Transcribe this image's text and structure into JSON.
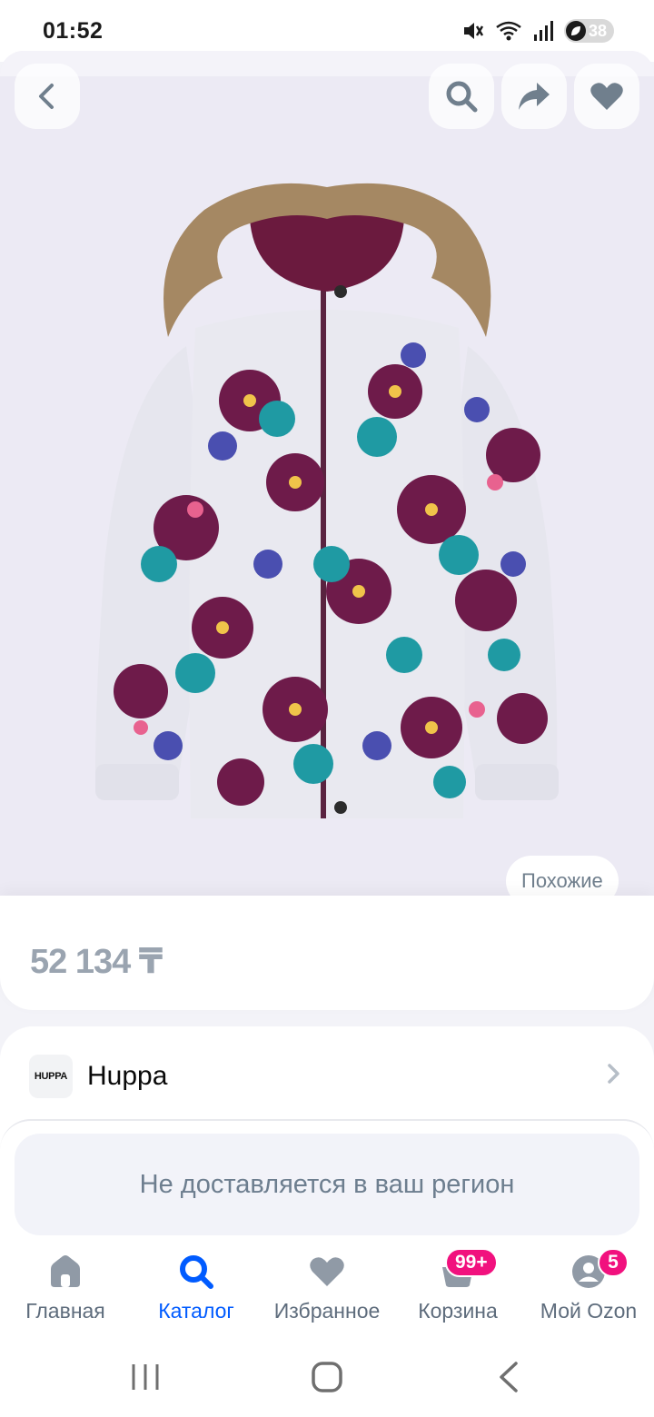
{
  "status_bar": {
    "time": "01:52",
    "battery_level": "38",
    "icons": [
      "mute-icon",
      "wifi-icon",
      "signal-icon",
      "battery-icon"
    ]
  },
  "product": {
    "image_alt": "jacket-image",
    "similar_button": "Похожие",
    "price": "52 134 ₸"
  },
  "header_actions": {
    "back_icon": "back-arrow-icon",
    "search_icon": "search-icon",
    "share_icon": "share-icon",
    "favorite_icon": "heart-icon"
  },
  "brand": {
    "logo_text": "HUPPA",
    "name": "Huppa"
  },
  "delivery": {
    "note": "Не доставляется в ваш регион"
  },
  "bottom_nav": {
    "items": [
      {
        "label": "Главная",
        "icon": "home-icon"
      },
      {
        "label": "Каталог",
        "icon": "search-icon",
        "active": true
      },
      {
        "label": "Избранное",
        "icon": "heart-icon"
      },
      {
        "label": "Корзина",
        "icon": "cart-icon",
        "badge": "99+"
      },
      {
        "label": "Мой Ozon",
        "icon": "profile-icon",
        "badge": "5"
      }
    ]
  },
  "colors": {
    "accent": "#005bff",
    "badge": "#f1117e",
    "price_gray": "#9aa4b0",
    "image_bg": "#eceaf4"
  }
}
